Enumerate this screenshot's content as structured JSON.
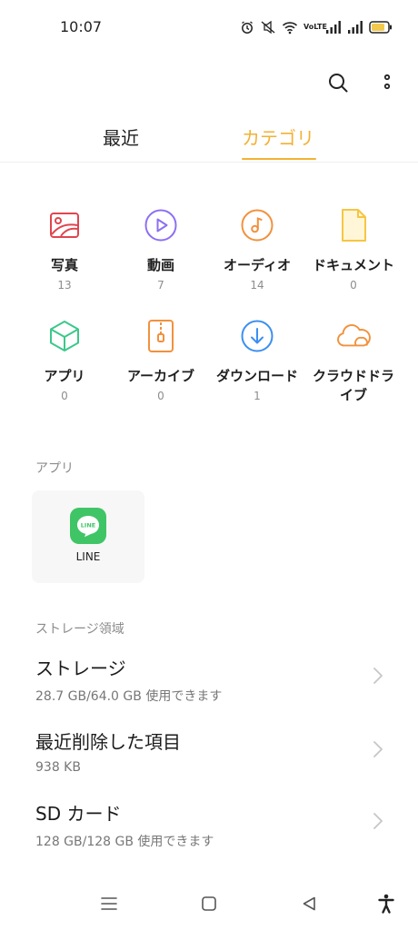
{
  "status_bar": {
    "time": "10:07",
    "network_label": "VoLTE",
    "icons": [
      "alarm-icon",
      "mute-icon",
      "wifi-icon",
      "volte-icon",
      "signal-icon",
      "signal-icon",
      "battery-icon"
    ],
    "battery_color": "#f2c94c"
  },
  "toolbar": {
    "icons": [
      "search-icon",
      "more-vertical-icon"
    ]
  },
  "tabs": [
    {
      "label": "最近",
      "active": false
    },
    {
      "label": "カテゴリ",
      "active": true
    }
  ],
  "accent_color": "#f2b233",
  "categories": [
    {
      "label": "写真",
      "count": "13",
      "icon": "photo-icon",
      "color": "#e0454f"
    },
    {
      "label": "動画",
      "count": "7",
      "icon": "video-icon",
      "color": "#8d6ff2"
    },
    {
      "label": "オーディオ",
      "count": "14",
      "icon": "audio-icon",
      "color": "#f2913c"
    },
    {
      "label": "ドキュメント",
      "count": "0",
      "icon": "document-icon",
      "color": "#f6c642"
    },
    {
      "label": "アプリ",
      "count": "0",
      "icon": "app-cube-icon",
      "color": "#3cc88a"
    },
    {
      "label": "アーカイブ",
      "count": "0",
      "icon": "archive-icon",
      "color": "#f2913c"
    },
    {
      "label": "ダウンロード",
      "count": "1",
      "icon": "download-icon",
      "color": "#3b8ff0"
    },
    {
      "label": "クラウドドライブ",
      "count": "",
      "icon": "cloud-icon",
      "color": "#f2913c"
    }
  ],
  "apps_section": {
    "label": "アプリ",
    "apps": [
      {
        "name": "LINE",
        "icon": "line-app-icon",
        "color": "#3fc566"
      }
    ]
  },
  "storage_section": {
    "label": "ストレージ領域",
    "items": [
      {
        "title": "ストレージ",
        "subtitle": "28.7 GB/64.0 GB 使用できます"
      },
      {
        "title": "最近削除した項目",
        "subtitle": "938 KB"
      },
      {
        "title": "SD カード",
        "subtitle": "128 GB/128 GB 使用できます"
      }
    ]
  },
  "nav_bar": {
    "icons": [
      "menu-icon",
      "home-square-icon",
      "back-triangle-icon",
      "accessibility-icon"
    ]
  }
}
